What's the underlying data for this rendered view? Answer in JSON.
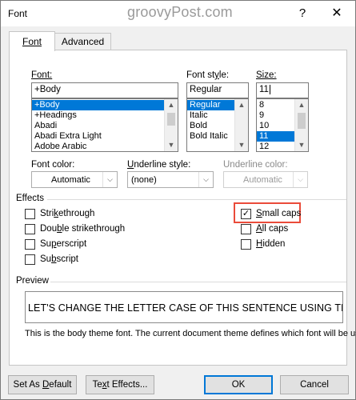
{
  "window": {
    "title": "Font",
    "watermark": "groovyPost.com",
    "help_label": "?",
    "close_label": "✕"
  },
  "tabs": [
    {
      "label": "Font",
      "selected": true
    },
    {
      "label": "Advanced",
      "selected": false
    }
  ],
  "font": {
    "label": "Font:",
    "value": "+Body",
    "items": [
      "+Body",
      "+Headings",
      "Abadi",
      "Abadi Extra Light",
      "Adobe Arabic"
    ],
    "selected_index": 0
  },
  "font_style": {
    "label": "Font style:",
    "value": "Regular",
    "items": [
      "Regular",
      "Italic",
      "Bold",
      "Bold Italic"
    ],
    "selected_index": 0
  },
  "size": {
    "label": "Size:",
    "value": "11",
    "items": [
      "8",
      "9",
      "10",
      "11",
      "12"
    ],
    "selected_index": 3
  },
  "font_color": {
    "label": "Font color:",
    "value": "Automatic"
  },
  "underline_style": {
    "label": "Underline style:",
    "value": "(none)"
  },
  "underline_color": {
    "label": "Underline color:",
    "value": "Automatic",
    "disabled": true
  },
  "effects": {
    "label": "Effects",
    "left": [
      {
        "label": "Strikethrough",
        "checked": false
      },
      {
        "label": "Double strikethrough",
        "checked": false
      },
      {
        "label": "Superscript",
        "checked": false
      },
      {
        "label": "Subscript",
        "checked": false
      }
    ],
    "right": [
      {
        "label": "Small caps",
        "checked": true
      },
      {
        "label": "All caps",
        "checked": false
      },
      {
        "label": "Hidden",
        "checked": false
      }
    ],
    "highlight_color": "#ea4b3a"
  },
  "preview": {
    "label": "Preview",
    "text": "LET'S CHANGE THE LETTER CASE OF THIS SENTENCE USING THE VARIET",
    "description": "This is the body theme font. The current document theme defines which font will be used."
  },
  "buttons": {
    "set_default": "Set As Default",
    "text_effects": "Text Effects...",
    "ok": "OK",
    "cancel": "Cancel"
  },
  "colors": {
    "selection": "#0078d7",
    "dialog_bg": "#f0f0f0"
  }
}
